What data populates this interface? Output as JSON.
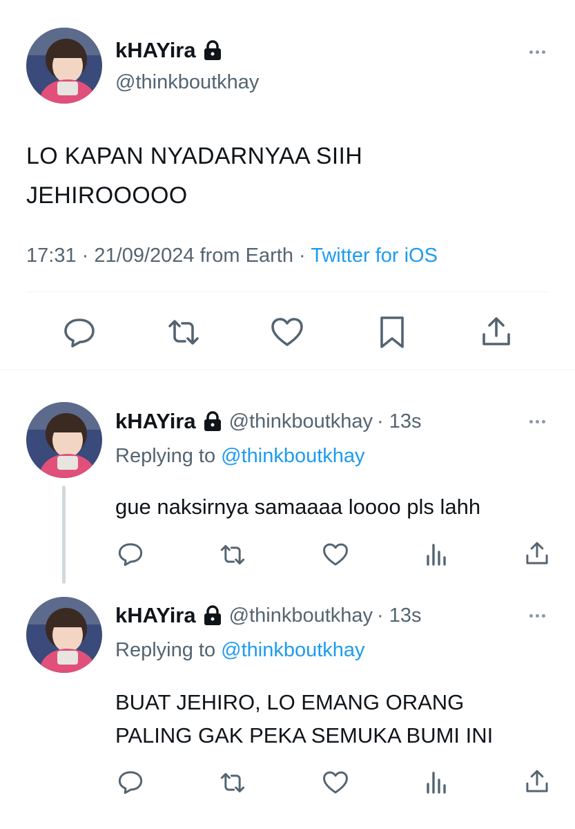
{
  "main_tweet": {
    "display_name": "kHAYira",
    "handle": "@thinkboutkhay",
    "text_line1": "LO KAPAN NYADARNYAA SIIH",
    "text_line2": "JEHIROOOOO",
    "time": "17:31",
    "date": "21/09/2024",
    "location": "from Earth",
    "separator": "·",
    "source": "Twitter for iOS",
    "actions": [
      "reply-icon",
      "retweet-icon",
      "like-icon",
      "bookmark-icon",
      "share-icon"
    ]
  },
  "replies": [
    {
      "display_name": "kHAYira",
      "handle": "@thinkboutkhay",
      "age": "· 13s",
      "replying_prefix": "Replying to",
      "replying_handle": "@thinkboutkhay",
      "text_line1": "gue naksirnya samaaaa loooo pls lahh",
      "text_line2": ""
    },
    {
      "display_name": "kHAYira",
      "handle": "@thinkboutkhay",
      "age": "· 13s",
      "replying_prefix": "Replying to",
      "replying_handle": "@thinkboutkhay",
      "text_line1": "BUAT JEHIRO, LO EMANG ORANG",
      "text_line2": "PALING GAK PEKA SEMUKA BUMI INI"
    }
  ],
  "colors": {
    "text": "#0f1419",
    "muted": "#536471",
    "link": "#1d9bf0",
    "divider": "#eff3f4"
  }
}
